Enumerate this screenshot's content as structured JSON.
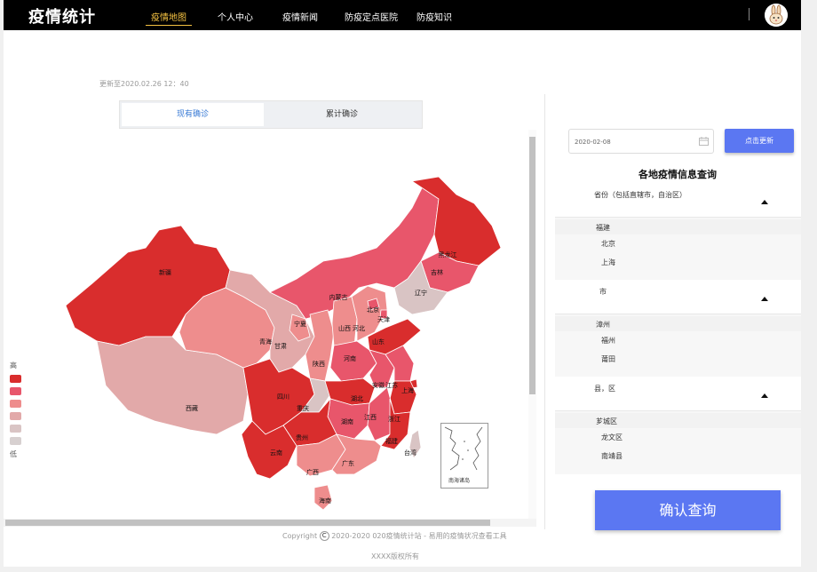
{
  "header": {
    "brand": "疫情统计",
    "nav": [
      {
        "label": "疫情地图",
        "active": true
      },
      {
        "label": "个人中心",
        "active": false
      },
      {
        "label": "疫情新闻",
        "active": false
      },
      {
        "label": "防疫定点医院",
        "active": false
      },
      {
        "label": "防疫知识",
        "active": false
      }
    ],
    "avatar_icon": "rabbit-avatar-icon"
  },
  "map_section": {
    "update_time": "更新至2020.02.26   12：40",
    "tabs": [
      "现有确诊",
      "累计确诊"
    ],
    "legend": {
      "high": "高",
      "low": "低",
      "colors": [
        "#d92d2d",
        "#e8566b",
        "#ee8d8d",
        "#e2a9a9",
        "#d9c4c4",
        "#d7d0d0"
      ]
    },
    "inset_label": "南海诸岛",
    "provinces": [
      {
        "name": "新疆",
        "level": 0
      },
      {
        "name": "西藏",
        "level": 3
      },
      {
        "name": "青海",
        "level": 2
      },
      {
        "name": "甘肃",
        "level": 3
      },
      {
        "name": "内蒙古",
        "level": 1
      },
      {
        "name": "黑龙江",
        "level": 0
      },
      {
        "name": "吉林",
        "level": 1
      },
      {
        "name": "辽宁",
        "level": 4
      },
      {
        "name": "宁夏",
        "level": 2
      },
      {
        "name": "陕西",
        "level": 2
      },
      {
        "name": "山西",
        "level": 2
      },
      {
        "name": "河北",
        "level": 2
      },
      {
        "name": "北京",
        "level": 1
      },
      {
        "name": "天津",
        "level": 1
      },
      {
        "name": "山东",
        "level": 0
      },
      {
        "name": "河南",
        "level": 1
      },
      {
        "name": "四川",
        "level": 0
      },
      {
        "name": "重庆",
        "level": 4
      },
      {
        "name": "湖北",
        "level": 0
      },
      {
        "name": "安徽",
        "level": 1
      },
      {
        "name": "江苏",
        "level": 1
      },
      {
        "name": "上海",
        "level": 0
      },
      {
        "name": "浙江",
        "level": 0
      },
      {
        "name": "湖南",
        "level": 1
      },
      {
        "name": "江西",
        "level": 1
      },
      {
        "name": "福建",
        "level": 0
      },
      {
        "name": "贵州",
        "level": 0
      },
      {
        "name": "云南",
        "level": 0
      },
      {
        "name": "广西",
        "level": 2
      },
      {
        "name": "广东",
        "level": 2
      },
      {
        "name": "海南",
        "level": 2
      },
      {
        "name": "台湾",
        "level": 4
      }
    ]
  },
  "query_panel": {
    "date_value": "2020-02-08",
    "update_button": "点击更新",
    "title": "各地疫情信息查询",
    "province_header": "省份（包括直辖市，自治区）",
    "province_selected": "福建",
    "province_options": [
      "北京",
      "上海"
    ],
    "city_header": "市",
    "city_selected": "漳州",
    "city_options": [
      "福州",
      "莆田"
    ],
    "county_header": "县，区",
    "county_selected": "芗城区",
    "county_options": [
      "龙文区",
      "南靖县"
    ],
    "confirm_button": "确认查询"
  },
  "footer": {
    "line1_prefix": "Copyright",
    "line1_rest": " 2020-2020 020疫情统计站 - 易用的疫情状况查看工具",
    "line2": "XXXX版权所有"
  }
}
